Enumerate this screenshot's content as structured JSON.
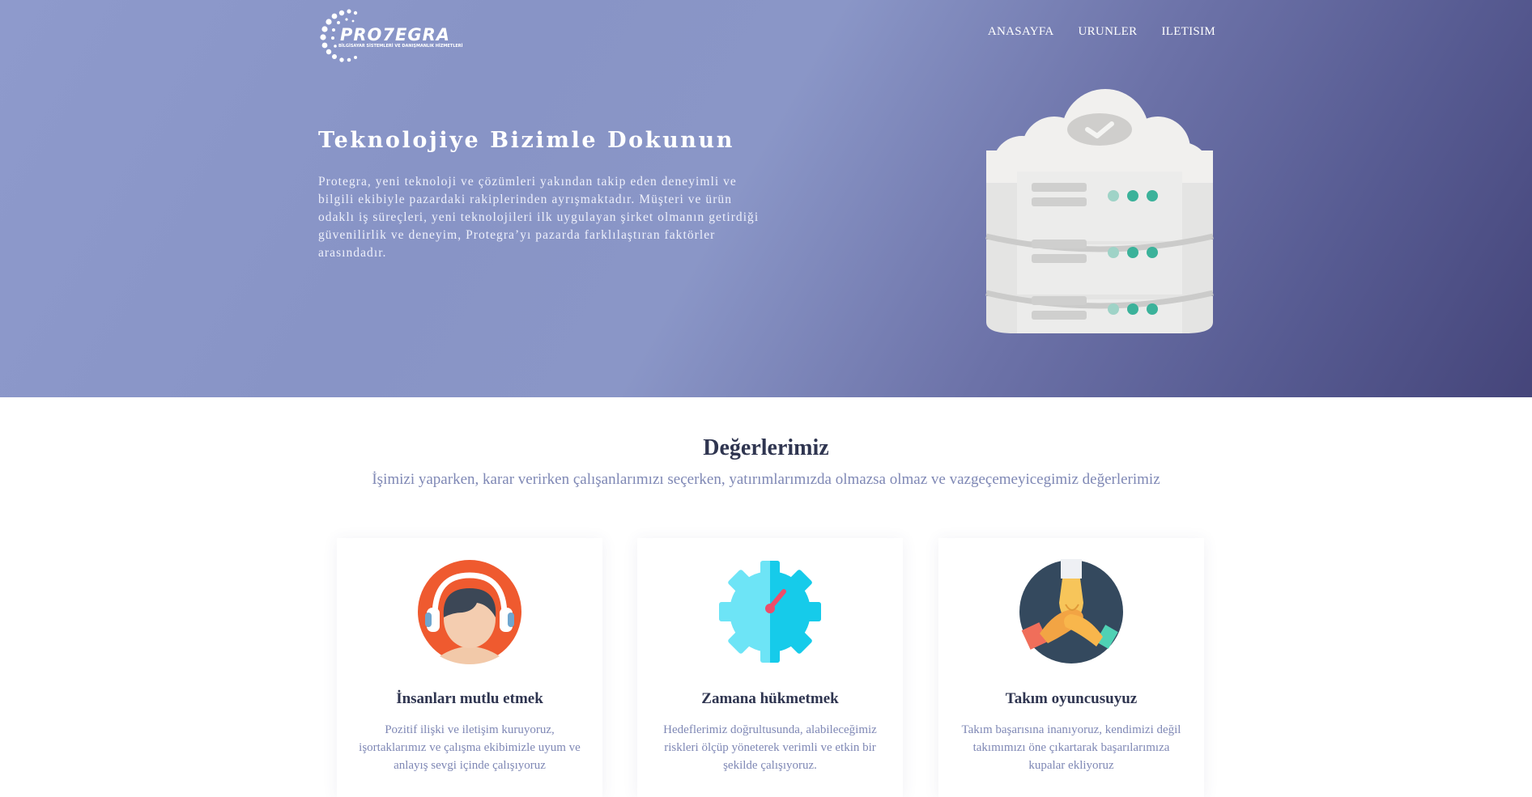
{
  "brand": {
    "name": "PRO7EGRA",
    "tagline": "BİLGİSAYAR SİSTEMLERİ VE DANIŞMANLIK HİZMETLERİ"
  },
  "nav": {
    "items": [
      {
        "label": "ANASAYFA"
      },
      {
        "label": "URUNLER"
      },
      {
        "label": "ILETISIM"
      }
    ]
  },
  "hero": {
    "title": "Teknolojiye Bizimle Dokunun",
    "text": "Protegra, yeni teknoloji ve çözümleri yakından takip eden deneyimli ve bilgili ekibiyle pazardaki rakiplerinden ayrışmaktadır. Müşteri ve ürün odaklı iş süreçleri, yeni teknolojileri ilk uygulayan şirket olmanın getirdiği güvenilirlik ve deneyim, Protegra’yı pazarda farklılaştıran faktörler arasındadır."
  },
  "values": {
    "title": "Değerlerimiz",
    "subtitle": "İşimizi yaparken, karar verirken çalışanlarımızı seçerken, yatırımlarımızda olmazsa olmaz ve vazgeçemeyicegimiz değerlerimiz",
    "cards": [
      {
        "icon": "headset-person-icon",
        "title": "İnsanları mutlu etmek",
        "text": "Pozitif ilişki ve iletişim kuruyoruz, işortaklarımız ve çalışma ekibimizle uyum ve anlayış sevgi içinde çalışıyoruz"
      },
      {
        "icon": "gear-gauge-icon",
        "title": "Zamana hükmetmek",
        "text": "Hedeflerimiz doğrultusunda, alabileceğimiz riskleri ölçüp yöneterek verimli ve etkin bir şekilde çalışıyoruz."
      },
      {
        "icon": "team-hands-icon",
        "title": "Takım oyuncusuyuz",
        "text": "Takım başarısına inanıyoruz, kendimizi değil takımımızı öne çıkartarak başarılarımıza kupalar ekliyoruz"
      }
    ]
  },
  "colors": {
    "hero_gradient_start": "#8e9acc",
    "hero_gradient_end": "#45457a",
    "accent_teal": "#3bb29a",
    "heading": "#2f3550",
    "muted_text": "#7f88b5"
  }
}
